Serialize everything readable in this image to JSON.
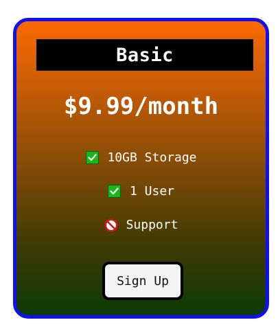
{
  "plan": {
    "name": "Basic",
    "price": "$9.99/month"
  },
  "features": [
    {
      "label": "10GB Storage",
      "icon": "check-icon",
      "included": true
    },
    {
      "label": "1 User",
      "icon": "check-icon",
      "included": true
    },
    {
      "label": "Support",
      "icon": "prohibited-icon",
      "included": false
    }
  ],
  "cta": {
    "label": "Sign Up"
  },
  "colors": {
    "border": "#1010ee",
    "gradient_top": "#fb6a00",
    "gradient_bottom": "#0c3a04",
    "title_bar": "#000000",
    "check": "#18b818",
    "prohibited": "#d01818"
  }
}
